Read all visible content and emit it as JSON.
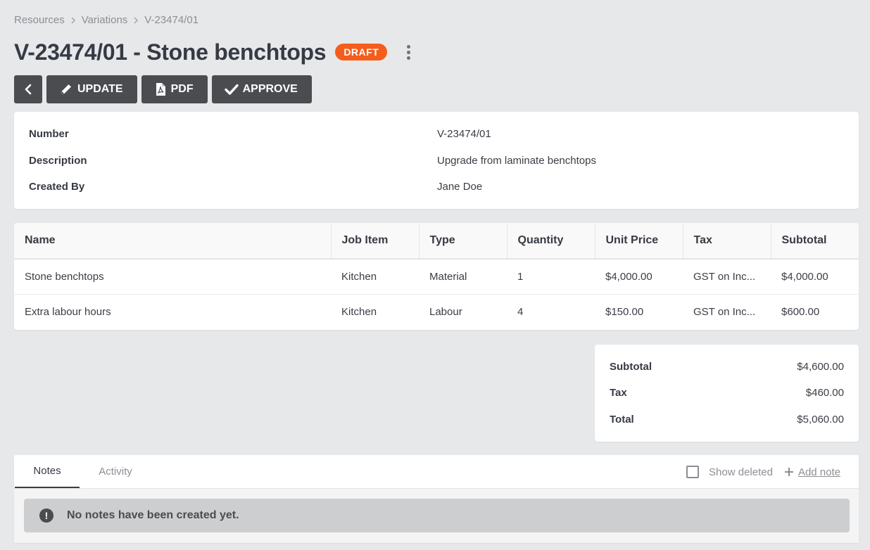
{
  "breadcrumb": [
    "Resources",
    "Variations",
    "V-23474/01"
  ],
  "title": "V-23474/01 - Stone benchtops",
  "status_badge": "DRAFT",
  "toolbar": {
    "update_label": "UPDATE",
    "pdf_label": "PDF",
    "approve_label": "APPROVE"
  },
  "details": [
    {
      "label": "Number",
      "value": "V-23474/01"
    },
    {
      "label": "Description",
      "value": "Upgrade from laminate benchtops"
    },
    {
      "label": "Created By",
      "value": "Jane Doe"
    }
  ],
  "items": {
    "columns": [
      "Name",
      "Job Item",
      "Type",
      "Quantity",
      "Unit Price",
      "Tax",
      "Subtotal"
    ],
    "rows": [
      [
        "Stone benchtops",
        "Kitchen",
        "Material",
        "1",
        "$4,000.00",
        "GST on Inc...",
        "$4,000.00"
      ],
      [
        "Extra labour hours",
        "Kitchen",
        "Labour",
        "4",
        "$150.00",
        "GST on Inc...",
        "$600.00"
      ]
    ]
  },
  "totals": [
    {
      "label": "Subtotal",
      "value": "$4,600.00"
    },
    {
      "label": "Tax",
      "value": "$460.00"
    },
    {
      "label": "Total",
      "value": "$5,060.00"
    }
  ],
  "notes": {
    "tabs": [
      "Notes",
      "Activity"
    ],
    "show_deleted_label": "Show deleted",
    "add_note_label": "Add note",
    "empty_message": "No notes have been created yet."
  },
  "colors": {
    "background": "#e7e8ea",
    "badge": "#f45d1b",
    "button": "#4a4c50"
  }
}
